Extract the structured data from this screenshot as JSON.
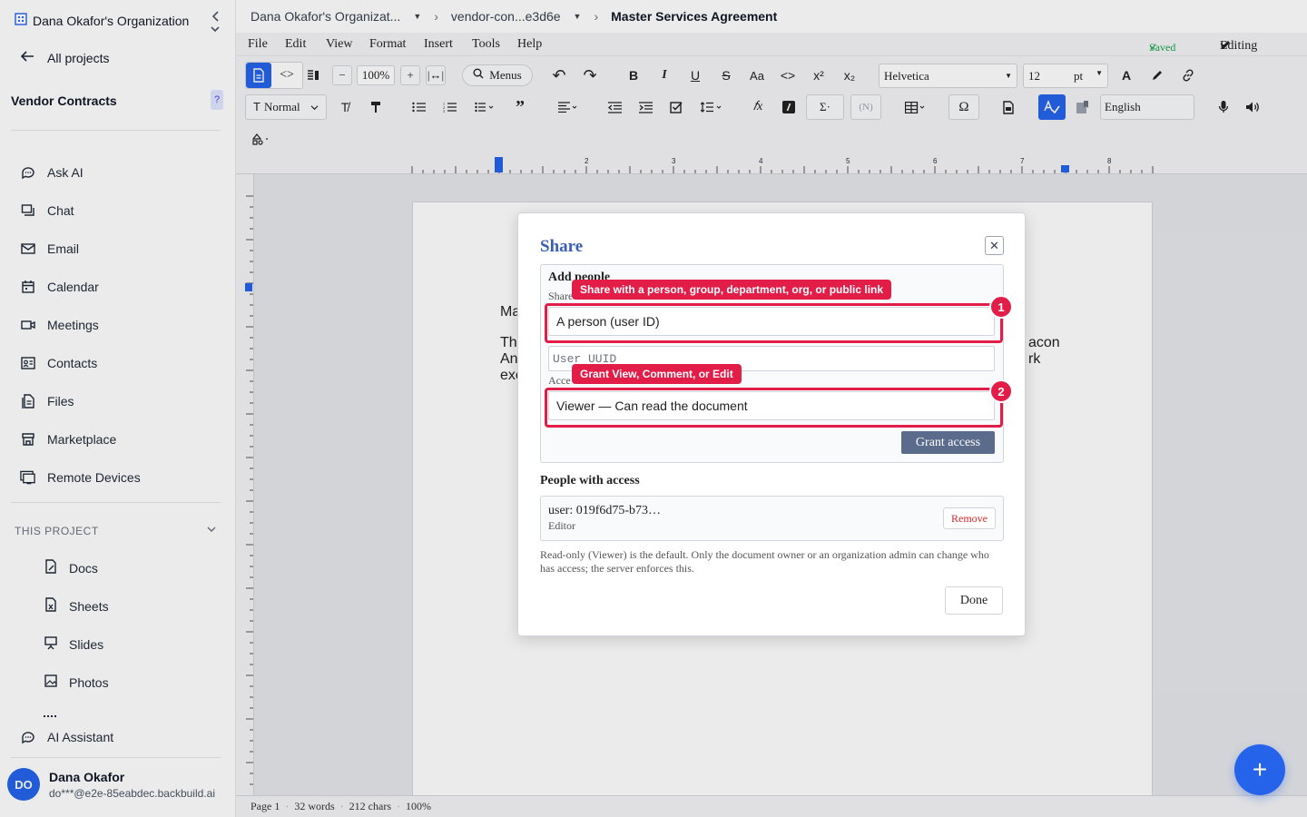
{
  "sidebar": {
    "org_name": "Dana Okafor's Organization",
    "all_projects": "All projects",
    "project_title": "Vendor Contracts",
    "help_badge": "?",
    "nav": [
      {
        "label": "Ask AI",
        "icon": "chat-bubble-icon"
      },
      {
        "label": "Chat",
        "icon": "messages-icon"
      },
      {
        "label": "Email",
        "icon": "mail-icon"
      },
      {
        "label": "Calendar",
        "icon": "calendar-icon"
      },
      {
        "label": "Meetings",
        "icon": "video-icon"
      },
      {
        "label": "Contacts",
        "icon": "contact-card-icon"
      },
      {
        "label": "Files",
        "icon": "files-icon"
      },
      {
        "label": "Marketplace",
        "icon": "store-icon"
      },
      {
        "label": "Remote Devices",
        "icon": "monitor-icon"
      }
    ],
    "section_heading": "THIS PROJECT",
    "project_items": [
      {
        "label": "Docs",
        "icon": "doc-icon"
      },
      {
        "label": "Sheets",
        "icon": "sheet-icon"
      },
      {
        "label": "Slides",
        "icon": "presentation-icon"
      },
      {
        "label": "Photos",
        "icon": "image-icon"
      }
    ],
    "ai_assistant": "AI Assistant",
    "user": {
      "initials": "DO",
      "name": "Dana Okafor",
      "email": "do***@e2e-85eabdec.backbuild.ai"
    }
  },
  "breadcrumb": {
    "org": "Dana Okafor's Organizat...",
    "repo": "vendor-con...e3d6e",
    "doc": "Master Services Agreement"
  },
  "menubar": {
    "items": [
      "File",
      "Edit",
      "View",
      "Format",
      "Insert",
      "Tools",
      "Help"
    ],
    "saved": "Saved",
    "mode": "Editing"
  },
  "toolbar": {
    "zoom": "100%",
    "menus": "Menus",
    "font": "Helvetica",
    "size": "12",
    "unit": "pt",
    "style": "Normal",
    "language": "English",
    "case": "Aa",
    "special_char": "Ω"
  },
  "ruler_numbers": [
    "2",
    "3",
    "4",
    "5",
    "6",
    "7",
    "8"
  ],
  "document": {
    "line1": "Ma",
    "line2a": "Th",
    "line2b": "acon",
    "line3a": "An",
    "line3b": "rk",
    "line4a": "exe"
  },
  "statusbar": {
    "page": "Page 1",
    "words": "32 words",
    "chars": "212 chars",
    "zoom": "100%"
  },
  "share_dialog": {
    "title": "Share",
    "add_people": "Add people",
    "share_with_label": "Share",
    "share_with_value": "A person (user ID)",
    "uuid_placeholder": "User UUID",
    "access_label": "Acce",
    "access_value": "Viewer — Can read the document",
    "grant_button": "Grant access",
    "people_heading": "People with access",
    "people": [
      {
        "user": "user: 019f6d75-b73…",
        "role": "Editor",
        "remove": "Remove"
      }
    ],
    "note": "Read-only (Viewer) is the default. Only the document owner or an organization admin can change who has access; the server enforces this.",
    "done": "Done"
  },
  "annotations": [
    {
      "num": "1",
      "tip": "Share with a person, group, department, org, or public link"
    },
    {
      "num": "2",
      "tip": "Grant View, Comment, or Edit"
    }
  ],
  "colors": {
    "accent": "#2563eb",
    "highlight": "#e11d48",
    "saved": "#16a34a"
  }
}
